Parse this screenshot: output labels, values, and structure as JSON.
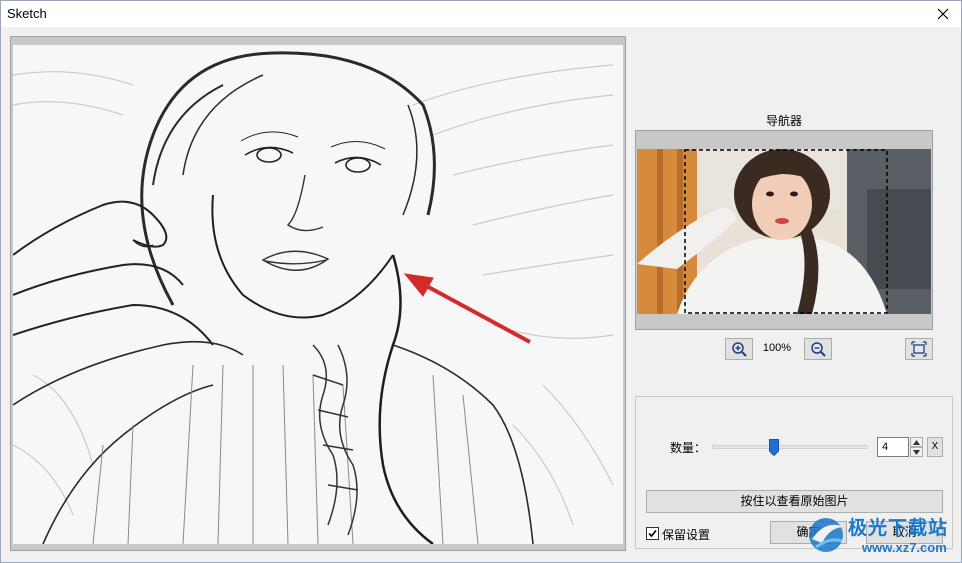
{
  "window": {
    "title": "Sketch"
  },
  "navigator": {
    "label": "导航器",
    "zoom_level": "100%"
  },
  "settings": {
    "amount_label": "数量：",
    "amount_value": "4",
    "amount_slider_fraction": 0.4,
    "reset_label": "X",
    "view_original_label": "按住以查看原始图片",
    "keep_settings_label": "保留设置",
    "keep_settings_checked": true
  },
  "buttons": {
    "ok_label": "确定",
    "cancel_label": "取消"
  },
  "watermark": {
    "title": "极光下载站",
    "url": "www.xz7.com"
  },
  "colors": {
    "arrow": "#d42a2a",
    "accent": "#1e6fd9",
    "watermark": "#1b78c8"
  },
  "icons": {
    "close": "close-icon",
    "zoom_in": "zoom-in-icon",
    "zoom_out": "zoom-out-icon",
    "fit": "fit-to-window-icon"
  }
}
